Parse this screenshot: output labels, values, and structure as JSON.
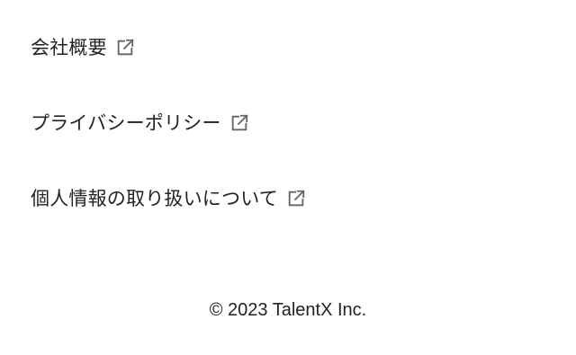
{
  "links": [
    {
      "label": "会社概要",
      "icon": "external-link-icon"
    },
    {
      "label": "プライバシーポリシー",
      "icon": "external-link-icon"
    },
    {
      "label": "個人情報の取り扱いについて",
      "icon": "external-link-icon"
    }
  ],
  "footer": {
    "copyright": "© 2023 TalentX Inc."
  },
  "colors": {
    "text": "#222222",
    "icon": "#666666",
    "background": "#ffffff"
  }
}
